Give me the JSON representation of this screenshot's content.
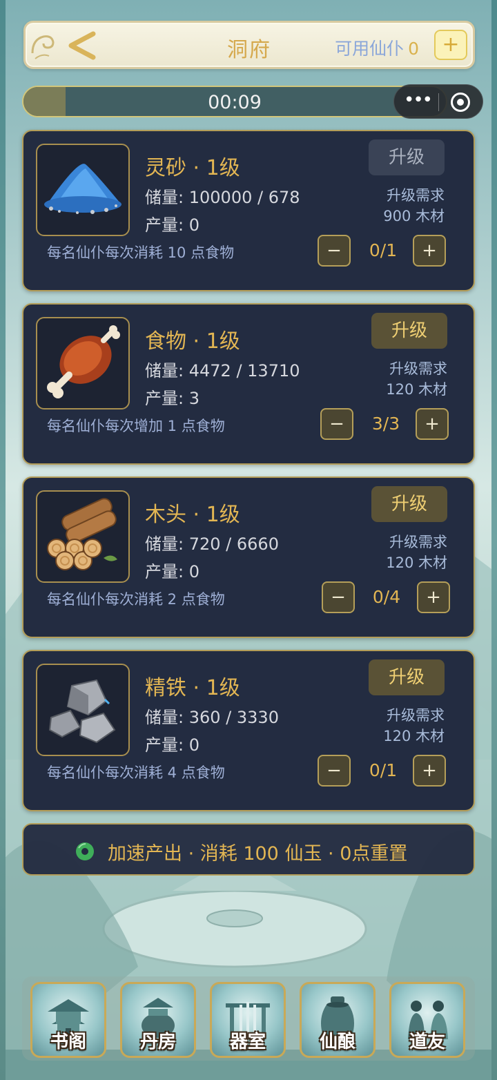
{
  "header": {
    "title": "洞府",
    "available_label": "可用仙仆",
    "available_count": "0",
    "plus_label": "+",
    "back_icon": "chevron-left-icon"
  },
  "timer": {
    "text": "00:09",
    "progress": 0.1
  },
  "capsule": {
    "more_label": "•••",
    "icons": [
      "more-dots-icon",
      "target-close-icon"
    ]
  },
  "resources": [
    {
      "name": "灵砂 · 1级",
      "storage_label": "储量:",
      "storage_value": "100000 / 678",
      "production_label": "产量:",
      "production_value": "0",
      "note": "每名仙仆每次消耗 10 点食物",
      "upgrade_label": "升级",
      "upgrade_enabled": false,
      "req_title": "升级需求",
      "req_value": "900 木材",
      "minus_label": "−",
      "plus_label": "+",
      "assigned": "0/1",
      "icon": "blue-sand-icon"
    },
    {
      "name": "食物 · 1级",
      "storage_label": "储量:",
      "storage_value": "4472 / 13710",
      "production_label": "产量:",
      "production_value": "3",
      "note": "每名仙仆每次增加 1 点食物",
      "upgrade_label": "升级",
      "upgrade_enabled": true,
      "req_title": "升级需求",
      "req_value": "120 木材",
      "minus_label": "−",
      "plus_label": "+",
      "assigned": "3/3",
      "icon": "roast-meat-icon"
    },
    {
      "name": "木头 · 1级",
      "storage_label": "储量:",
      "storage_value": "720 / 6660",
      "production_label": "产量:",
      "production_value": "0",
      "note": "每名仙仆每次消耗 2 点食物",
      "upgrade_label": "升级",
      "upgrade_enabled": true,
      "req_title": "升级需求",
      "req_value": "120 木材",
      "minus_label": "−",
      "plus_label": "+",
      "assigned": "0/4",
      "icon": "log-bundle-icon"
    },
    {
      "name": "精铁 · 1级",
      "storage_label": "储量:",
      "storage_value": "360 / 3330",
      "production_label": "产量:",
      "production_value": "0",
      "note": "每名仙仆每次消耗 4 点食物",
      "upgrade_label": "升级",
      "upgrade_enabled": true,
      "req_title": "升级需求",
      "req_value": "120 木材",
      "minus_label": "−",
      "plus_label": "+",
      "assigned": "0/1",
      "icon": "iron-ore-icon"
    }
  ],
  "speed_bar": {
    "text": "加速产出 · 消耗 100 仙玉 · 0点重置",
    "icon": "jade-icon"
  },
  "bottom_nav": [
    {
      "label": "书阁",
      "icon": "pavilion-icon"
    },
    {
      "label": "丹房",
      "icon": "alchemy-cauldron-icon"
    },
    {
      "label": "器室",
      "icon": "weapon-rack-icon"
    },
    {
      "label": "仙酿",
      "icon": "wine-jar-icon"
    },
    {
      "label": "道友",
      "icon": "companions-icon"
    }
  ],
  "colors": {
    "card_bg": "#232c41",
    "card_border": "#b39d58",
    "gold_text": "#e3b653",
    "note_text": "#9fb0d6",
    "header_title": "#d5a84c",
    "header_avail": "#8aa6d9"
  }
}
